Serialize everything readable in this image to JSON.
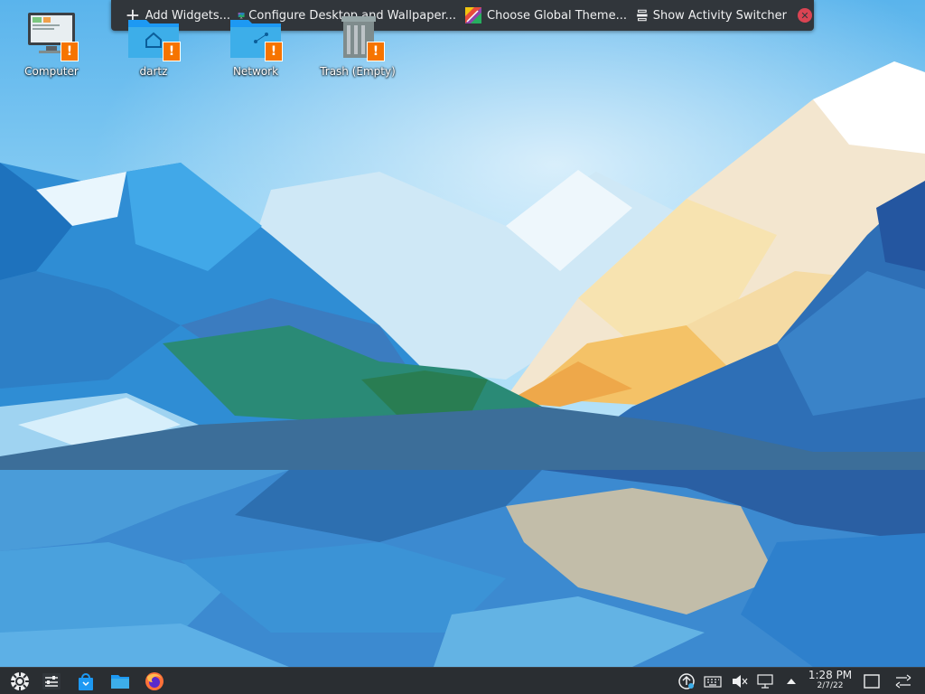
{
  "toolbox": {
    "add_widgets": "Add Widgets...",
    "configure_desktop": "Configure Desktop and Wallpaper...",
    "global_theme": "Choose Global Theme...",
    "activity_switcher": "Show Activity Switcher",
    "close_icon": "close-icon"
  },
  "desktop_icons": [
    {
      "label": "Computer",
      "icon": "computer-icon",
      "badge": "!"
    },
    {
      "label": "dartz",
      "icon": "home-folder-icon",
      "badge": "!"
    },
    {
      "label": "Network",
      "icon": "network-folder-icon",
      "badge": "!"
    },
    {
      "label": "Trash (Empty)",
      "icon": "trash-icon",
      "badge": "!"
    }
  ],
  "panel": {
    "launchers": [
      "application-menu-icon",
      "system-settings-icon",
      "discover-store-icon",
      "dolphin-file-manager-icon",
      "firefox-icon"
    ],
    "tray": [
      "updates-icon",
      "keyboard-icon",
      "volume-muted-icon",
      "network-wired-icon",
      "tray-expand-icon"
    ],
    "clock_time": "1:28 PM",
    "clock_date": "2/7/22",
    "show_desktop": "show-desktop-icon",
    "panel_settings": "panel-settings-icon"
  },
  "colors": {
    "panel_bg": "#2a2e32",
    "toolbox_bg": "#31363b",
    "warning_badge": "#f67400",
    "close_red": "#da4453",
    "accent": "#3daee9"
  }
}
